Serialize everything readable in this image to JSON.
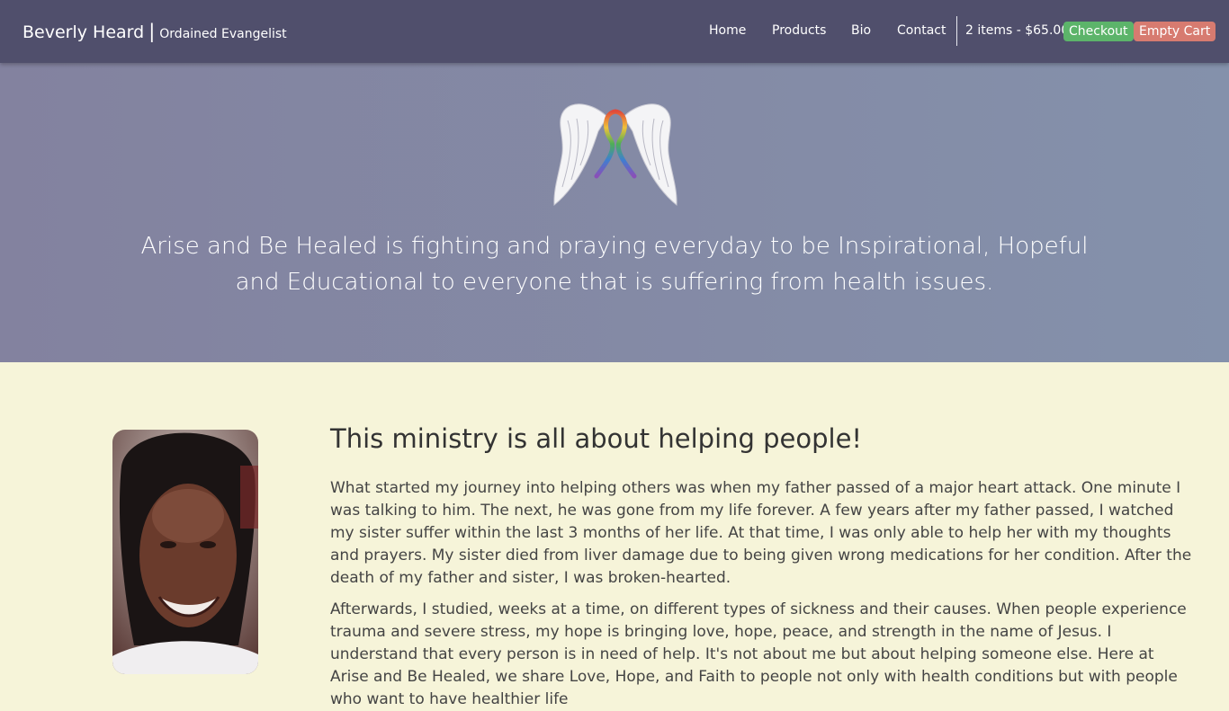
{
  "header": {
    "brand_name": "Beverly Heard",
    "brand_separator": "|",
    "brand_subtitle": "Ordained Evangelist",
    "nav": [
      "Home",
      "Products",
      "Bio",
      "Contact"
    ],
    "cart_summary": "2 items - $65.00",
    "checkout_label": "Checkout",
    "empty_cart_label": "Empty Cart"
  },
  "hero": {
    "logo_icon": "angel-wings-ribbon-icon",
    "tagline": "Arise and Be Healed is fighting and praying everyday to be Inspirational, Hopeful and Educational to everyone that is suffering from health issues."
  },
  "main": {
    "heading": "This ministry is all about helping people!",
    "paragraphs": [
      "What started my journey into helping others was when my father passed of a major heart attack. One minute I was talking to him. The next, he was gone from my life forever. A few years after my father passed, I watched my sister suffer within the last 3 months of her life. At that time, I was only able to help her with my thoughts and prayers. My sister died from liver damage due to being given wrong medications for her condition. After the death of my father and sister, I was broken-hearted.",
      "Afterwards, I studied, weeks at a time, on different types of sickness and their causes. When people experience trauma and severe stress, my hope is bringing love, hope, peace, and strength in the name of Jesus. I understand that every person is in need of help. It's not about me but about helping someone else. Here at Arise and Be Healed, we share Love, Hope, and Faith to people not only with health conditions but with people who want to have healthier life"
    ]
  },
  "colors": {
    "navbar": "#504f6c",
    "hero_start": "#83829f",
    "hero_end": "#8491ab",
    "content_bg": "#f6f4d9",
    "checkout": "#5cb46a",
    "empty_cart": "#d77b70"
  }
}
